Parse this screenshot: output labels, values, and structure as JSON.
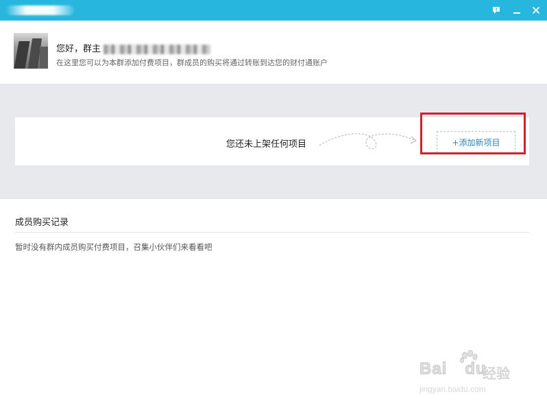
{
  "window": {
    "title": "",
    "controls": [
      "feedback-icon",
      "minimize-icon",
      "close-icon"
    ],
    "accent_color": "#27b7de"
  },
  "header": {
    "greeting": "您好，群主",
    "subtitle": "在这里您可以为本群添加付费项目，群成员的购买将通过转账到达您的财付通账户"
  },
  "items_panel": {
    "empty_text": "您还未上架任何项目",
    "add_button": "+添加新项目",
    "highlight_color": "#d2212b"
  },
  "records": {
    "title": "成员购买记录",
    "empty_text": "暂时没有群内成员购买付费项目，召集小伙伴们来看看吧"
  },
  "watermark": {
    "logo": "Bai",
    "logo2": "du",
    "text": "经验",
    "url": "jingyan.baidu.com"
  }
}
